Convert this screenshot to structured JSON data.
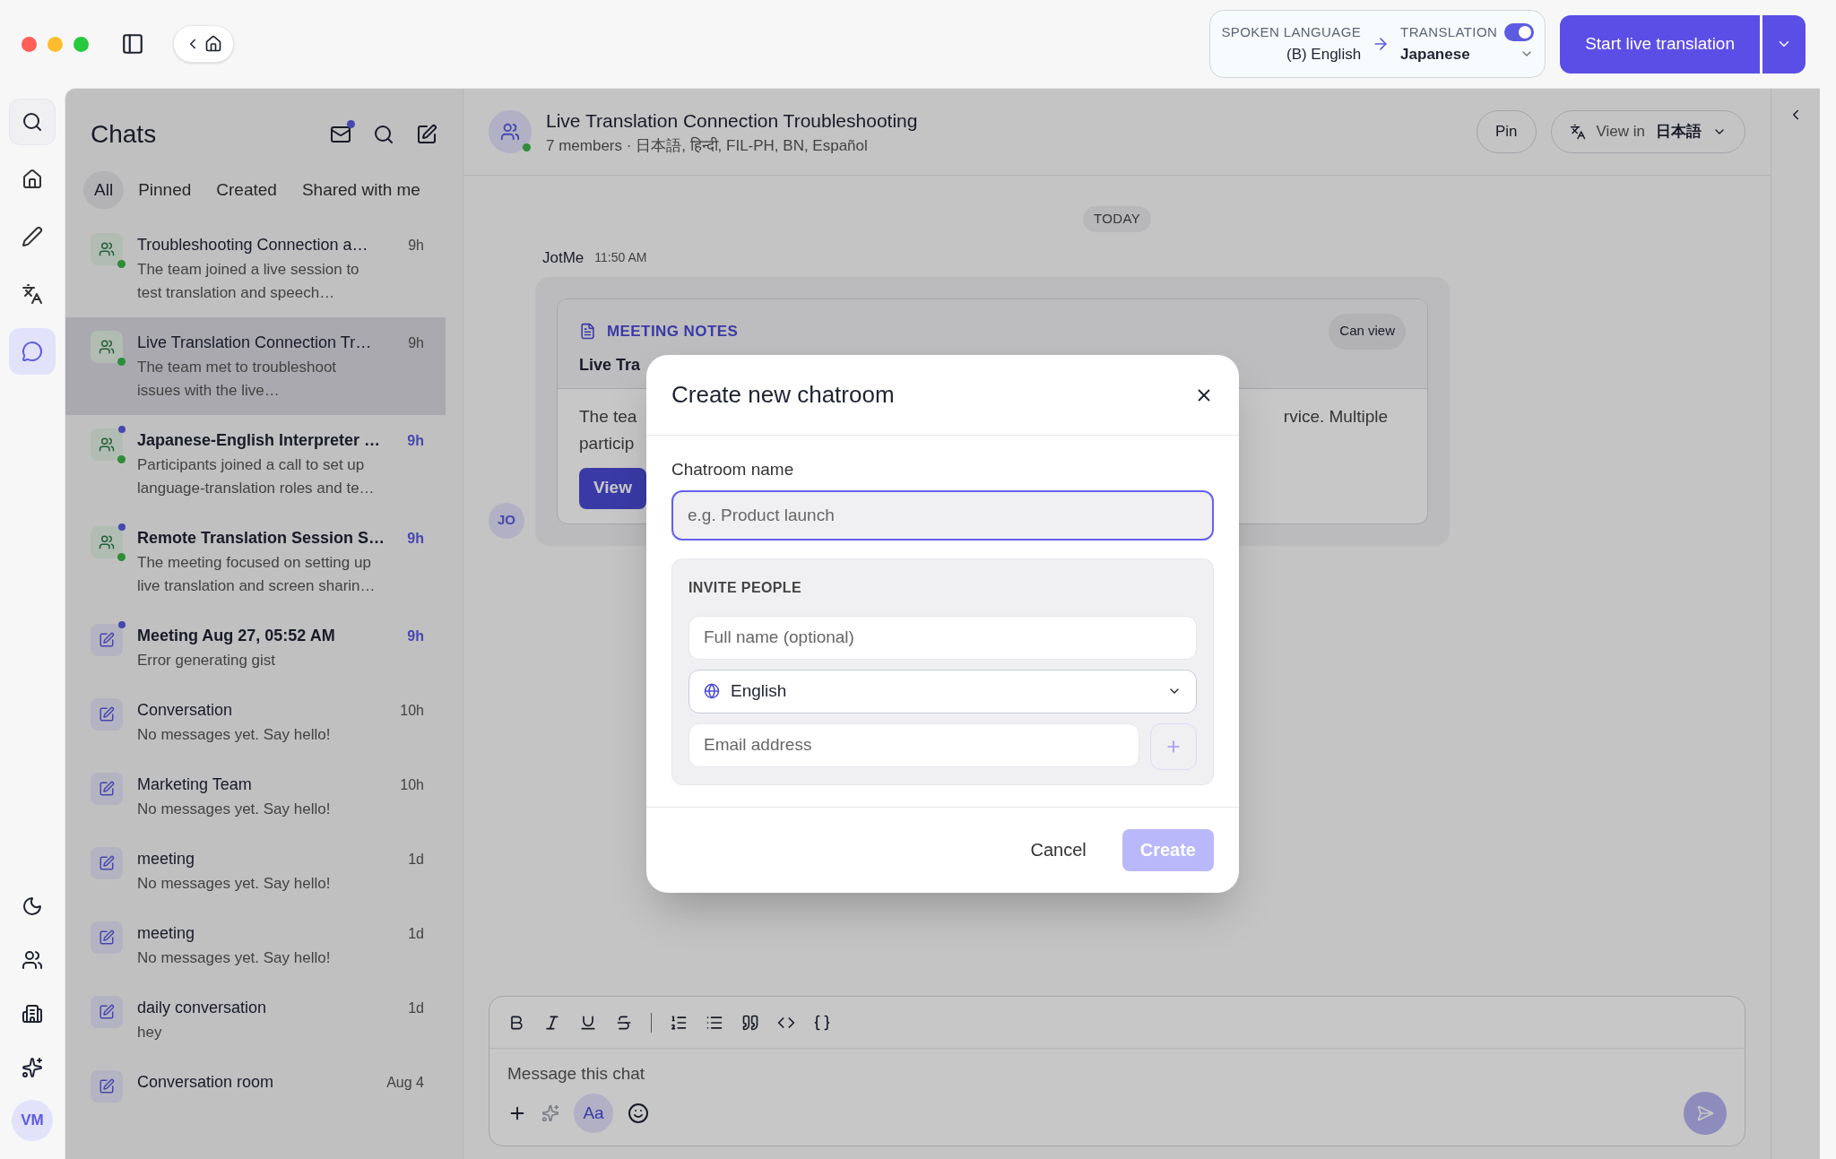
{
  "language_bar": {
    "spoken_label": "SPOKEN LANGUAGE",
    "spoken_value": "(B) English",
    "translation_label": "TRANSLATION",
    "translation_on": true,
    "translation_value": "Japanese"
  },
  "start_button": {
    "label": "Start live translation"
  },
  "rail": {
    "items": [
      {
        "selected": false
      },
      {
        "selected": false
      },
      {
        "selected": false
      },
      {
        "selected": true
      }
    ],
    "avatar": "VM"
  },
  "chats": {
    "title": "Chats",
    "mail_unread": true,
    "tabs": [
      {
        "label": "All",
        "selected": true
      },
      {
        "label": "Pinned",
        "selected": false
      },
      {
        "label": "Created",
        "selected": false
      },
      {
        "label": "Shared with me",
        "selected": false
      }
    ],
    "items": [
      {
        "kind": "group",
        "title": "Troubleshooting Connection a…",
        "preview": [
          "The team joined a live session to",
          "test translation and speech…"
        ],
        "time": "9h",
        "unread": false,
        "online": true,
        "selected": false
      },
      {
        "kind": "group",
        "title": "Live Translation Connection Tr…",
        "preview": [
          "The team met to troubleshoot",
          "issues with the live…"
        ],
        "time": "9h",
        "unread": false,
        "online": true,
        "selected": true
      },
      {
        "kind": "group",
        "title": "Japanese-English Interpreter …",
        "preview": [
          "Participants joined a call to set up",
          "language-translation roles and te…"
        ],
        "time": "9h",
        "unread": true,
        "online": true,
        "selected": false
      },
      {
        "kind": "group",
        "title": "Remote Translation Session S…",
        "preview": [
          "The meeting focused on setting up",
          "live translation and screen sharin…"
        ],
        "time": "9h",
        "unread": true,
        "online": true,
        "selected": false
      },
      {
        "kind": "note",
        "title": "Meeting Aug 27, 05:52 AM",
        "preview": [
          "Error generating gist"
        ],
        "time": "9h",
        "unread": true,
        "online": false,
        "selected": false
      },
      {
        "kind": "note",
        "title": "Conversation",
        "preview": [
          "No messages yet. Say hello!"
        ],
        "time": "10h",
        "unread": false,
        "online": false,
        "selected": false
      },
      {
        "kind": "note",
        "title": "Marketing Team",
        "preview": [
          "No messages yet. Say hello!"
        ],
        "time": "10h",
        "unread": false,
        "online": false,
        "selected": false
      },
      {
        "kind": "note",
        "title": "meeting",
        "preview": [
          "No messages yet. Say hello!"
        ],
        "time": "1d",
        "unread": false,
        "online": false,
        "selected": false
      },
      {
        "kind": "note",
        "title": "meeting",
        "preview": [
          "No messages yet. Say hello!"
        ],
        "time": "1d",
        "unread": false,
        "online": false,
        "selected": false
      },
      {
        "kind": "note",
        "title": "daily conversation",
        "preview": [
          "hey"
        ],
        "time": "1d",
        "unread": false,
        "online": false,
        "selected": false
      },
      {
        "kind": "note",
        "title": "Conversation room",
        "time": "Aug 4",
        "unread": false,
        "online": false,
        "selected": false
      }
    ]
  },
  "conversation": {
    "title": "Live Translation Connection Troubleshooting",
    "subtitle": "7 members · 日本語, हिन्दी, FIL-PH, BN, Español",
    "online": true,
    "pin": "Pin",
    "view_in": "View in",
    "view_in_lang": "日本語",
    "date": "TODAY",
    "sender": "JotMe",
    "time": "11:50 AM",
    "avatar": "JO",
    "card": {
      "label": "MEETING NOTES",
      "badge": "Can view",
      "title": "Live Tra",
      "body_left": [
        "The tea",
        "particip"
      ],
      "body_right": "rvice. Multiple",
      "button": "View"
    },
    "composer": {
      "placeholder": "Message this chat",
      "format_button": "Aa",
      "format_on": true
    }
  },
  "modal": {
    "title": "Create new chatroom",
    "name_label": "Chatroom name",
    "name_placeholder": "e.g. Product launch",
    "section": "INVITE PEOPLE",
    "fullname_placeholder": "Full name (optional)",
    "language": "English",
    "email_placeholder": "Email address",
    "cancel": "Cancel",
    "create": "Create",
    "create_disabled": true
  }
}
